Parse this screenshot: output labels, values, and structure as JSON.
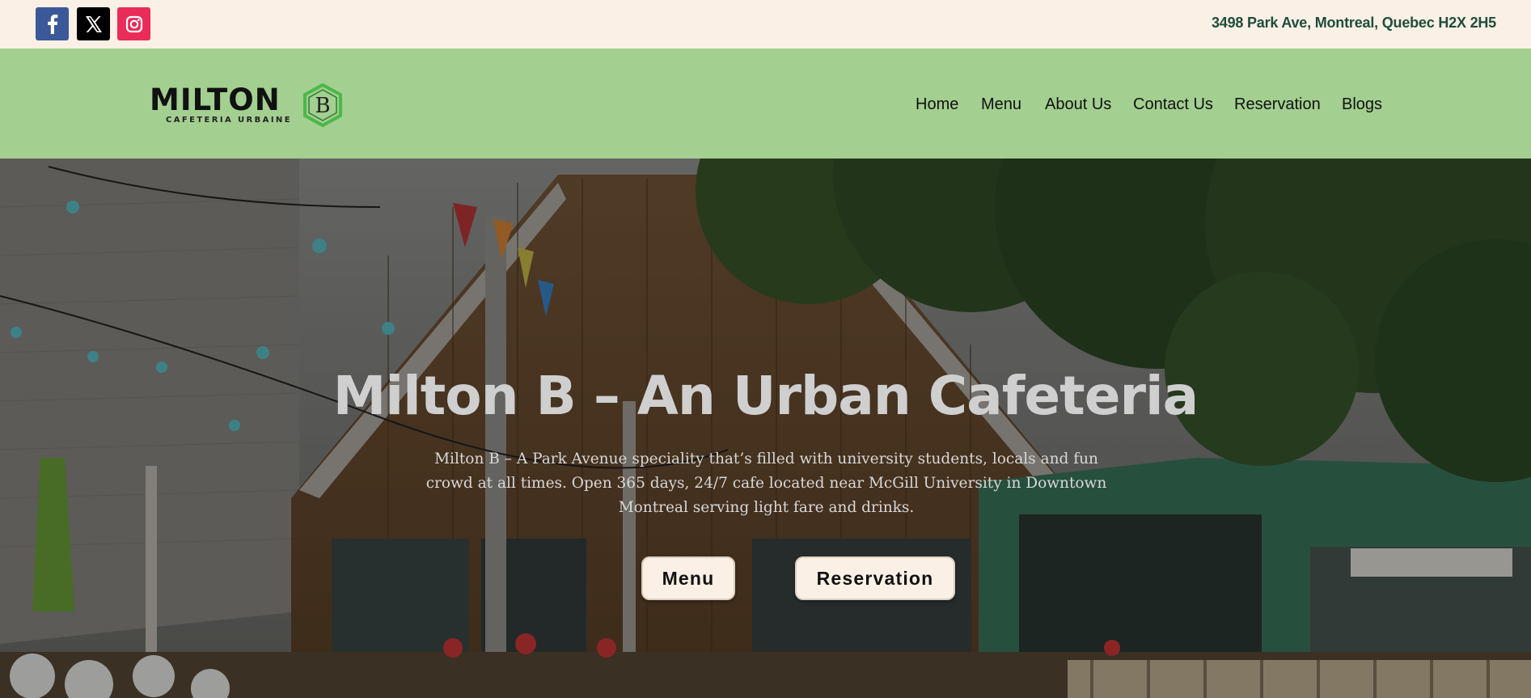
{
  "topbar": {
    "social": [
      {
        "name": "facebook-icon",
        "glyph": "f"
      },
      {
        "name": "x-twitter-icon",
        "glyph": "X"
      },
      {
        "name": "instagram-icon",
        "glyph": "ig"
      }
    ],
    "address": "3498 Park Ave, Montreal, Quebec H2X 2H5"
  },
  "header": {
    "logo": {
      "word": "MILTON",
      "badge": "B",
      "subtitle": "CAFETERIA URBAINE"
    },
    "nav": [
      "Home",
      "Menu",
      "About Us",
      "Contact Us",
      "Reservation",
      "Blogs"
    ]
  },
  "hero": {
    "title": "Milton B – An Urban Cafeteria",
    "description": "Milton B – A Park Avenue speciality that’s filled with university students, locals and fun crowd at all times. Open 365 days, 24/7 cafe located near McGill University in Downtown Montreal serving light fare and drinks.",
    "buttons": {
      "menu": "Menu",
      "reservation": "Reservation"
    }
  },
  "colors": {
    "topbar_bg": "#faf0e6",
    "header_bg": "#a3cf91",
    "address": "#1f4d3a",
    "logo_accent": "#4bb848",
    "button_bg": "#faf0e6"
  }
}
